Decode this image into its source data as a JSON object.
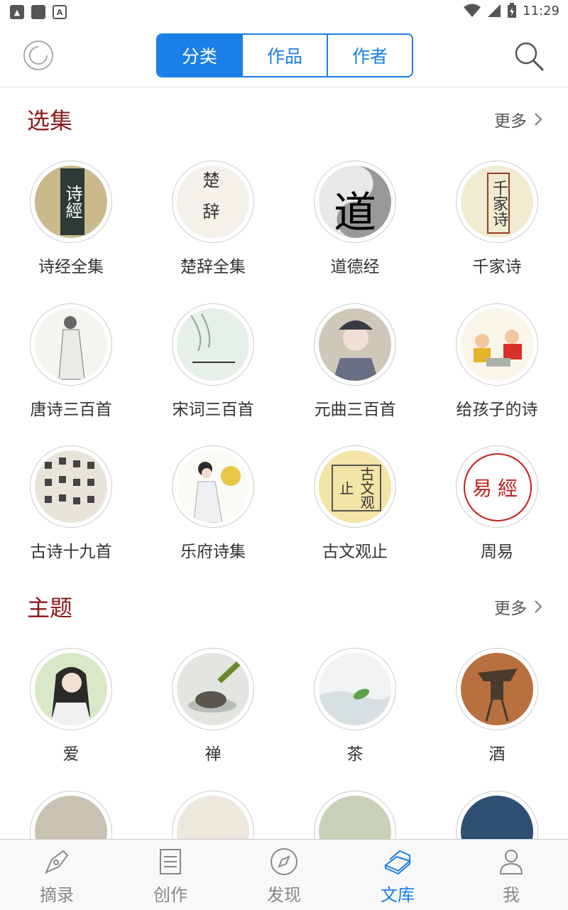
{
  "status": {
    "time": "11:29"
  },
  "header": {
    "tabs": [
      "分类",
      "作品",
      "作者"
    ]
  },
  "sections": [
    {
      "title": "选集",
      "more": "更多",
      "items": [
        {
          "label": "诗经全集",
          "art": "诗經"
        },
        {
          "label": "楚辞全集",
          "art": "楚辞"
        },
        {
          "label": "道德经",
          "art": "道"
        },
        {
          "label": "千家诗",
          "art": "千家诗"
        },
        {
          "label": "唐诗三百首"
        },
        {
          "label": "宋词三百首"
        },
        {
          "label": "元曲三百首"
        },
        {
          "label": "给孩子的诗"
        },
        {
          "label": "古诗十九首"
        },
        {
          "label": "乐府诗集"
        },
        {
          "label": "古文观止",
          "art": "古文观止"
        },
        {
          "label": "周易",
          "art": "易經"
        }
      ]
    },
    {
      "title": "主题",
      "more": "更多",
      "items": [
        {
          "label": "爱"
        },
        {
          "label": "禅"
        },
        {
          "label": "茶"
        },
        {
          "label": "酒"
        }
      ]
    }
  ],
  "tabbar": [
    {
      "label": "摘录",
      "icon": "pen-nib-icon"
    },
    {
      "label": "创作",
      "icon": "document-icon"
    },
    {
      "label": "发现",
      "icon": "compass-icon"
    },
    {
      "label": "文库",
      "icon": "books-icon",
      "active": true
    },
    {
      "label": "我",
      "icon": "person-icon"
    }
  ],
  "colors": {
    "accent": "#1a7fe8",
    "section_title": "#8b1a1a"
  }
}
